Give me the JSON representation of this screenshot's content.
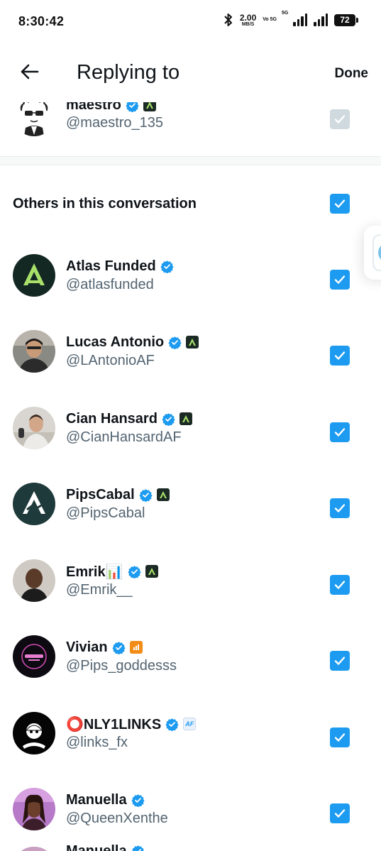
{
  "status_bar": {
    "time": "8:30:42",
    "speed_value": "2.00",
    "speed_unit": "MB/S",
    "volte": "Vo 5G",
    "network": "5G",
    "battery": "72",
    "icons": [
      "bluetooth-icon",
      "signal-icon",
      "battery-icon"
    ]
  },
  "header": {
    "title": "Replying to",
    "done_label": "Done",
    "back_icon": "back-arrow-icon"
  },
  "primary": {
    "name": "maestro",
    "handle": "@maestro_135",
    "checked": true,
    "disabled": true
  },
  "section": {
    "title": "Others in this conversation",
    "checked": true
  },
  "users": [
    {
      "name": "Atlas Funded",
      "handle": "@atlasfunded",
      "affiliate": "none",
      "checked": true
    },
    {
      "name": "Lucas Antonio",
      "handle": "@LAntonioAF",
      "affiliate": "atlas",
      "checked": true
    },
    {
      "name": "Cian Hansard",
      "handle": "@CianHansardAF",
      "affiliate": "atlas",
      "checked": true
    },
    {
      "name": "PipsCabal",
      "handle": "@PipsCabal",
      "affiliate": "atlas",
      "checked": true
    },
    {
      "name": "Emrik📊",
      "handle": "@Emrik__",
      "affiliate": "atlas",
      "checked": true
    },
    {
      "name": "Vivian",
      "handle": "@Pips_goddesss",
      "affiliate": "orange",
      "checked": true
    },
    {
      "name": "⭕NLY1LINKS",
      "handle": "@links_fx",
      "affiliate": "AF",
      "checked": true
    },
    {
      "name": "Manuella",
      "handle": "@QueenXenthe",
      "affiliate": "none",
      "checked": true
    },
    {
      "name": "Manuella",
      "handle": "",
      "affiliate": "none",
      "checked": true
    }
  ],
  "colors": {
    "accent": "#1d9bf0",
    "text": "#0f1419",
    "secondary": "#536471",
    "disabled_checkbox": "#cfd9de",
    "affiliate_dark": "#1b2a25",
    "affiliate_green": "#a8e06a"
  }
}
